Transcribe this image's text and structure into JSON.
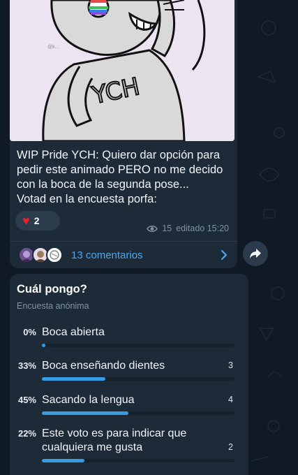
{
  "post": {
    "text_lines": [
      "WIP Pride YCH: Quiero dar opción para",
      "pedir este animado PERO no me decido",
      "con la boca de la segunda pose...",
      "Votad en la encuesta porfa:"
    ],
    "image_shirt_text": "YCH",
    "image_watermark": "@k...",
    "reaction": {
      "emoji": "♥",
      "count": "2"
    },
    "views": "15",
    "edited": "editado 15:20",
    "comments_label": "13 comentarios"
  },
  "poll": {
    "question": "Cuál pongo?",
    "type": "Encuesta anónima",
    "options": [
      {
        "percent_label": "0%",
        "label_lines": [
          "Boca abierta"
        ],
        "votes": "",
        "fraction": 0.0
      },
      {
        "percent_label": "33%",
        "label_lines": [
          "Boca enseñando dientes"
        ],
        "votes": "3",
        "fraction": 0.33
      },
      {
        "percent_label": "45%",
        "label_lines": [
          "Sacando la lengua"
        ],
        "votes": "4",
        "fraction": 0.45
      },
      {
        "percent_label": "22%",
        "label_lines": [
          "Este voto es para indicar que",
          "cualquiera me gusta"
        ],
        "votes": "2",
        "fraction": 0.22
      }
    ]
  },
  "icons": {
    "views": "eye-icon",
    "open_comments": "chevron-right-icon",
    "share": "share-arrow-icon",
    "reaction": "heart-icon"
  },
  "colors": {
    "background": "#0f1a24",
    "bubble": "#1d2a37",
    "accent": "#3a9be5",
    "link": "#4ea7f0",
    "muted": "#7f92a6",
    "heart": "#e5232f"
  }
}
